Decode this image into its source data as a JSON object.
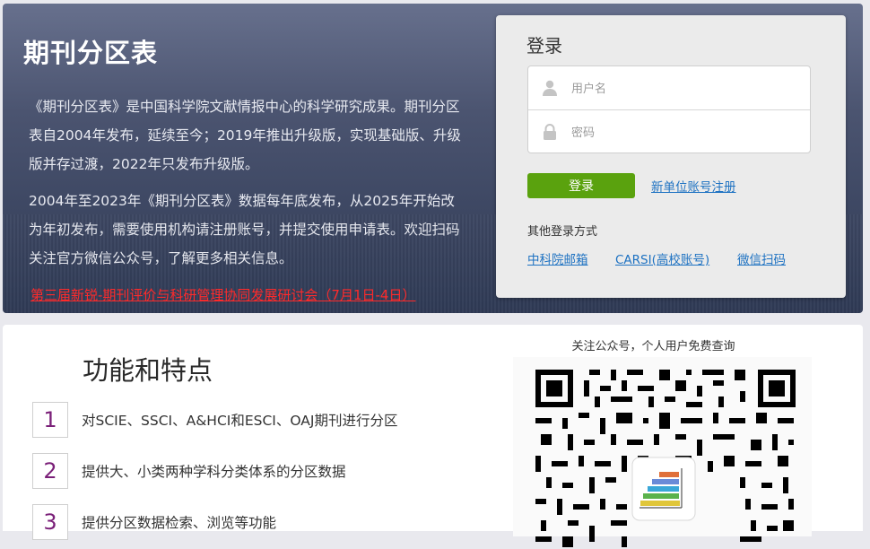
{
  "hero": {
    "title": "期刊分区表",
    "desc1": "《期刊分区表》是中国科学院文献情报中心的科学研究成果。期刊分区表自2004年发布，延续至今；2019年推出升级版，实现基础版、升级版并存过渡，2022年只发布升级版。",
    "desc2": "2004年至2023年《期刊分区表》数据每年底发布，从2025年开始改为年初发布，需要使用机构请注册账号，并提交使用申请表。欢迎扫码关注官方微信公众号，了解更多相关信息。",
    "event_link": "第三届新锐-期刊评价与科研管理协同发展研讨会（7月1日-4日）"
  },
  "login": {
    "title": "登录",
    "username_placeholder": "用户名",
    "password_placeholder": "密码",
    "submit_label": "登录",
    "register_link": "新单位账号注册",
    "other_title": "其他登录方式",
    "other_methods": [
      "中科院邮箱",
      "CARSI(高校账号)",
      "微信扫码"
    ]
  },
  "features": {
    "title": "功能和特点",
    "items": [
      {
        "num": "1",
        "text": "对SCIE、SSCI、A&HCI和ESCI、OAJ期刊进行分区"
      },
      {
        "num": "2",
        "text": "提供大、小类两种学科分类体系的分区数据"
      },
      {
        "num": "3",
        "text": "提供分区数据检索、浏览等功能"
      }
    ]
  },
  "qr": {
    "caption": "关注公众号，个人用户免费查询"
  },
  "colors": {
    "accent_green": "#5aa20e",
    "link_blue": "#1e72c2",
    "event_red": "#ff2a2a",
    "number_purple": "#7a1f78"
  },
  "icons": {
    "username": "user-icon",
    "password": "lock-icon",
    "qr_logo": "bar-chart-logo"
  }
}
